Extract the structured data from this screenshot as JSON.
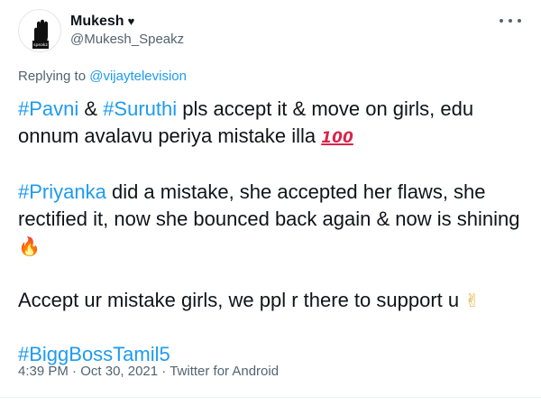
{
  "author": {
    "display_name": "Mukesh",
    "heart": "♥",
    "handle": "@Mukesh_Speakz",
    "avatar_icon": "fist-logo-icon",
    "avatar_text": "speakz"
  },
  "reply": {
    "prefix": "Replying to ",
    "to_handle": "@vijaytelevision"
  },
  "tweet": {
    "p1": {
      "tag1": "#Pavni",
      "t1": " & ",
      "tag2": "#Suruthi",
      "t2": " pls accept it & move on girls, edu onnum avalavu periya mistake illa ",
      "emoji": "100"
    },
    "p2": {
      "tag": "#Priyanka",
      "t": " did a mistake, she accepted her flaws, she rectified it, now she bounced back again & now is shining ",
      "emoji": "🔥"
    },
    "p3": {
      "t": "Accept ur mistake girls, we ppl r there to support u ",
      "emoji": "✌"
    },
    "p4": {
      "tag": "#BiggBossTamil5"
    }
  },
  "meta": {
    "time": "4:39 PM",
    "sep1": " · ",
    "date": "Oct 30, 2021",
    "sep2": " · ",
    "source": "Twitter for Android"
  },
  "colors": {
    "link": "#1d9bf0",
    "text": "#0f1419",
    "muted": "#536471"
  }
}
